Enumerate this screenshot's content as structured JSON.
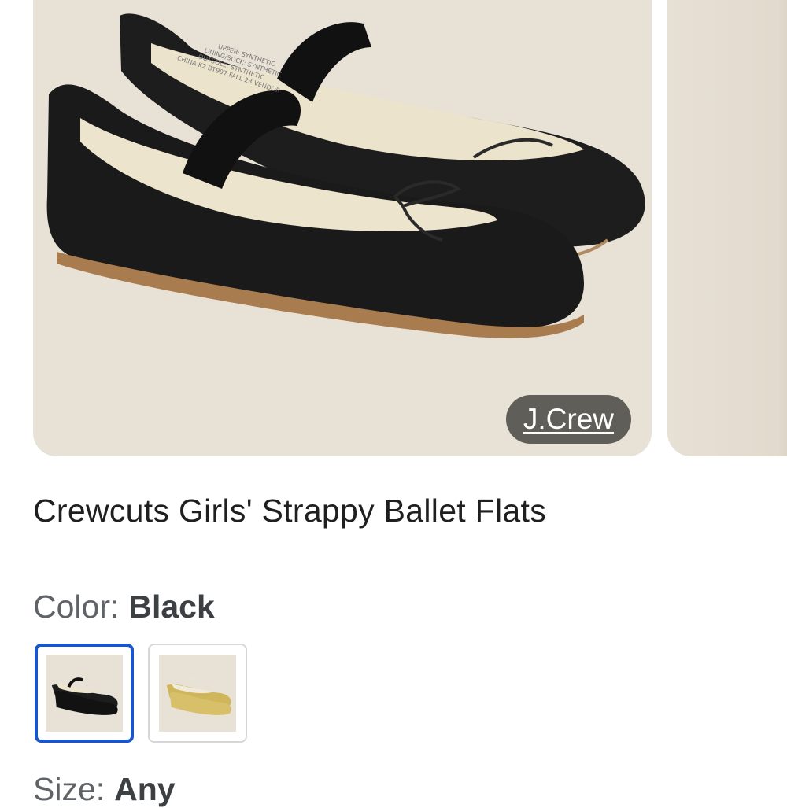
{
  "product": {
    "brand": "J.Crew",
    "title": "Crewcuts Girls' Strappy Ballet Flats",
    "shoe_label_lines": [
      "UPPER: SYNTHETIC",
      "LINING/SOCK: SYNTHETIC",
      "OUTSOLE: SYNTHETIC",
      "CHINA K2 BT997 FALL 23 VENDOR"
    ]
  },
  "color": {
    "label": "Color:",
    "value": "Black",
    "options": [
      {
        "name": "black-variant",
        "selected": true
      },
      {
        "name": "gold-variant",
        "selected": false
      }
    ],
    "selected_border": "#1a56c8"
  },
  "size": {
    "label": "Size:",
    "value": "Any"
  }
}
